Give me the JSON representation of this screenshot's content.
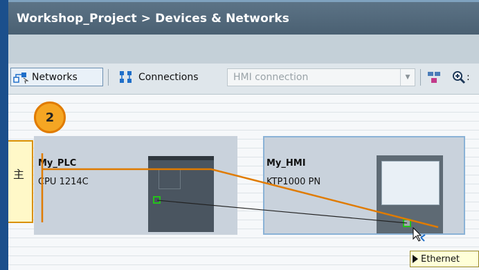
{
  "title": "Workshop_Project > Devices & Networks",
  "toolbar": {
    "networks_label": "Networks",
    "connections_label": "Connections",
    "connection_type": "HMI connection"
  },
  "step_number": "2",
  "note_char": "主",
  "devices": {
    "plc": {
      "name": "My_PLC",
      "type": "CPU 1214C"
    },
    "hmi": {
      "name": "My_HMI",
      "type": "KTP1000 PN"
    }
  },
  "tooltip": "Ethernet",
  "colors": {
    "accent_orange": "#e07b00",
    "port_green": "#24c21a",
    "title_bg": "#4a6072"
  }
}
